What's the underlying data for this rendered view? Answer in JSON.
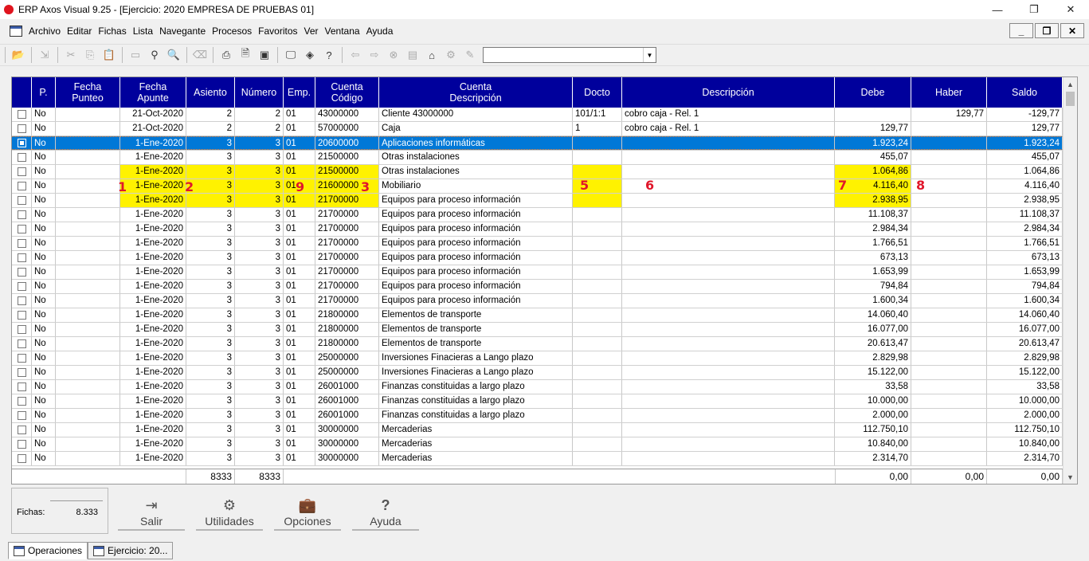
{
  "window": {
    "title": "ERP Axos Visual 9.25 - [Ejercicio: 2020  EMPRESA DE PRUEBAS 01]"
  },
  "menu": [
    "Archivo",
    "Editar",
    "Fichas",
    "Lista",
    "Navegante",
    "Procesos",
    "Favoritos",
    "Ver",
    "Ventana",
    "Ayuda"
  ],
  "headers": {
    "p": "P.",
    "fecha_punteo": "Fecha\nPunteo",
    "fecha_apunte": "Fecha\nApunte",
    "asiento": "Asiento",
    "numero": "Número",
    "emp": "Emp.",
    "cuenta_codigo": "Cuenta\nCódigo",
    "cuenta_desc": "Cuenta\nDescripción",
    "docto": "Docto",
    "descripcion": "Descripción",
    "debe": "Debe",
    "haber": "Haber",
    "saldo": "Saldo"
  },
  "rows": [
    {
      "p": "No",
      "fp": "",
      "fa": "21-Oct-2020",
      "as": "2",
      "nu": "2",
      "em": "01",
      "cc": "43000000",
      "cd": "Cliente 43000000",
      "dc": "101/1:1",
      "de": "cobro caja - Rel. 1",
      "debe": "",
      "haber": "129,77",
      "saldo": "-129,77"
    },
    {
      "p": "No",
      "fp": "",
      "fa": "21-Oct-2020",
      "as": "2",
      "nu": "2",
      "em": "01",
      "cc": "57000000",
      "cd": "Caja",
      "dc": "1",
      "de": "cobro caja - Rel. 1",
      "debe": "129,77",
      "haber": "",
      "saldo": "129,77"
    },
    {
      "p": "No",
      "fp": "",
      "fa": "1-Ene-2020",
      "as": "3",
      "nu": "3",
      "em": "01",
      "cc": "20600000",
      "cd": "Aplicaciones informáticas",
      "dc": "",
      "de": "",
      "debe": "1.923,24",
      "haber": "",
      "saldo": "1.923,24"
    },
    {
      "p": "No",
      "fp": "",
      "fa": "1-Ene-2020",
      "as": "3",
      "nu": "3",
      "em": "01",
      "cc": "21500000",
      "cd": "Otras instalaciones",
      "dc": "",
      "de": "",
      "debe": "455,07",
      "haber": "",
      "saldo": "455,07"
    },
    {
      "p": "No",
      "fp": "",
      "fa": "1-Ene-2020",
      "as": "3",
      "nu": "3",
      "em": "01",
      "cc": "21500000",
      "cd": "Otras instalaciones",
      "dc": "",
      "de": "",
      "debe": "1.064,86",
      "haber": "",
      "saldo": "1.064,86"
    },
    {
      "p": "No",
      "fp": "",
      "fa": "1-Ene-2020",
      "as": "3",
      "nu": "3",
      "em": "01",
      "cc": "21600000",
      "cd": "Mobiliario",
      "dc": "",
      "de": "",
      "debe": "4.116,40",
      "haber": "",
      "saldo": "4.116,40"
    },
    {
      "p": "No",
      "fp": "",
      "fa": "1-Ene-2020",
      "as": "3",
      "nu": "3",
      "em": "01",
      "cc": "21700000",
      "cd": "Equipos para proceso información",
      "dc": "",
      "de": "",
      "debe": "2.938,95",
      "haber": "",
      "saldo": "2.938,95"
    },
    {
      "p": "No",
      "fp": "",
      "fa": "1-Ene-2020",
      "as": "3",
      "nu": "3",
      "em": "01",
      "cc": "21700000",
      "cd": "Equipos para proceso información",
      "dc": "",
      "de": "",
      "debe": "11.108,37",
      "haber": "",
      "saldo": "11.108,37"
    },
    {
      "p": "No",
      "fp": "",
      "fa": "1-Ene-2020",
      "as": "3",
      "nu": "3",
      "em": "01",
      "cc": "21700000",
      "cd": "Equipos para proceso información",
      "dc": "",
      "de": "",
      "debe": "2.984,34",
      "haber": "",
      "saldo": "2.984,34"
    },
    {
      "p": "No",
      "fp": "",
      "fa": "1-Ene-2020",
      "as": "3",
      "nu": "3",
      "em": "01",
      "cc": "21700000",
      "cd": "Equipos para proceso información",
      "dc": "",
      "de": "",
      "debe": "1.766,51",
      "haber": "",
      "saldo": "1.766,51"
    },
    {
      "p": "No",
      "fp": "",
      "fa": "1-Ene-2020",
      "as": "3",
      "nu": "3",
      "em": "01",
      "cc": "21700000",
      "cd": "Equipos para proceso información",
      "dc": "",
      "de": "",
      "debe": "673,13",
      "haber": "",
      "saldo": "673,13"
    },
    {
      "p": "No",
      "fp": "",
      "fa": "1-Ene-2020",
      "as": "3",
      "nu": "3",
      "em": "01",
      "cc": "21700000",
      "cd": "Equipos para proceso información",
      "dc": "",
      "de": "",
      "debe": "1.653,99",
      "haber": "",
      "saldo": "1.653,99"
    },
    {
      "p": "No",
      "fp": "",
      "fa": "1-Ene-2020",
      "as": "3",
      "nu": "3",
      "em": "01",
      "cc": "21700000",
      "cd": "Equipos para proceso información",
      "dc": "",
      "de": "",
      "debe": "794,84",
      "haber": "",
      "saldo": "794,84"
    },
    {
      "p": "No",
      "fp": "",
      "fa": "1-Ene-2020",
      "as": "3",
      "nu": "3",
      "em": "01",
      "cc": "21700000",
      "cd": "Equipos para proceso información",
      "dc": "",
      "de": "",
      "debe": "1.600,34",
      "haber": "",
      "saldo": "1.600,34"
    },
    {
      "p": "No",
      "fp": "",
      "fa": "1-Ene-2020",
      "as": "3",
      "nu": "3",
      "em": "01",
      "cc": "21800000",
      "cd": "Elementos de transporte",
      "dc": "",
      "de": "",
      "debe": "14.060,40",
      "haber": "",
      "saldo": "14.060,40"
    },
    {
      "p": "No",
      "fp": "",
      "fa": "1-Ene-2020",
      "as": "3",
      "nu": "3",
      "em": "01",
      "cc": "21800000",
      "cd": "Elementos de transporte",
      "dc": "",
      "de": "",
      "debe": "16.077,00",
      "haber": "",
      "saldo": "16.077,00"
    },
    {
      "p": "No",
      "fp": "",
      "fa": "1-Ene-2020",
      "as": "3",
      "nu": "3",
      "em": "01",
      "cc": "21800000",
      "cd": "Elementos de transporte",
      "dc": "",
      "de": "",
      "debe": "20.613,47",
      "haber": "",
      "saldo": "20.613,47"
    },
    {
      "p": "No",
      "fp": "",
      "fa": "1-Ene-2020",
      "as": "3",
      "nu": "3",
      "em": "01",
      "cc": "25000000",
      "cd": "Inversiones Finacieras a Lango plazo",
      "dc": "",
      "de": "",
      "debe": "2.829,98",
      "haber": "",
      "saldo": "2.829,98"
    },
    {
      "p": "No",
      "fp": "",
      "fa": "1-Ene-2020",
      "as": "3",
      "nu": "3",
      "em": "01",
      "cc": "25000000",
      "cd": "Inversiones Finacieras a Lango plazo",
      "dc": "",
      "de": "",
      "debe": "15.122,00",
      "haber": "",
      "saldo": "15.122,00"
    },
    {
      "p": "No",
      "fp": "",
      "fa": "1-Ene-2020",
      "as": "3",
      "nu": "3",
      "em": "01",
      "cc": "26001000",
      "cd": "Finanzas constituidas a largo plazo",
      "dc": "",
      "de": "",
      "debe": "33,58",
      "haber": "",
      "saldo": "33,58"
    },
    {
      "p": "No",
      "fp": "",
      "fa": "1-Ene-2020",
      "as": "3",
      "nu": "3",
      "em": "01",
      "cc": "26001000",
      "cd": "Finanzas constituidas a largo plazo",
      "dc": "",
      "de": "",
      "debe": "10.000,00",
      "haber": "",
      "saldo": "10.000,00"
    },
    {
      "p": "No",
      "fp": "",
      "fa": "1-Ene-2020",
      "as": "3",
      "nu": "3",
      "em": "01",
      "cc": "26001000",
      "cd": "Finanzas constituidas a largo plazo",
      "dc": "",
      "de": "",
      "debe": "2.000,00",
      "haber": "",
      "saldo": "2.000,00"
    },
    {
      "p": "No",
      "fp": "",
      "fa": "1-Ene-2020",
      "as": "3",
      "nu": "3",
      "em": "01",
      "cc": "30000000",
      "cd": "Mercaderias",
      "dc": "",
      "de": "",
      "debe": "112.750,10",
      "haber": "",
      "saldo": "112.750,10"
    },
    {
      "p": "No",
      "fp": "",
      "fa": "1-Ene-2020",
      "as": "3",
      "nu": "3",
      "em": "01",
      "cc": "30000000",
      "cd": "Mercaderias",
      "dc": "",
      "de": "",
      "debe": "10.840,00",
      "haber": "",
      "saldo": "10.840,00"
    },
    {
      "p": "No",
      "fp": "",
      "fa": "1-Ene-2020",
      "as": "3",
      "nu": "3",
      "em": "01",
      "cc": "30000000",
      "cd": "Mercaderias",
      "dc": "",
      "de": "",
      "debe": "2.314,70",
      "haber": "",
      "saldo": "2.314,70"
    }
  ],
  "selected_row": 2,
  "highlight_rows": [
    4,
    5,
    6
  ],
  "highlight_color": "#fff200",
  "selection_color": "#0078d7",
  "header_color": "#00009c",
  "markers": [
    "1",
    "2",
    "9",
    "3",
    "5",
    "6",
    "7",
    "8"
  ],
  "totals": {
    "asiento": "8333",
    "numero": "8333",
    "debe": "0,00",
    "haber": "0,00",
    "saldo": "0,00"
  },
  "fichas": {
    "label": "Fichas:",
    "value": "8.333"
  },
  "buttons": [
    {
      "label": "Salir",
      "icon": "exit-icon"
    },
    {
      "label": "Utilidades",
      "icon": "gear-icon"
    },
    {
      "label": "Opciones",
      "icon": "briefcase-icon"
    },
    {
      "label": "Ayuda",
      "icon": "question-icon"
    }
  ],
  "tabs": [
    {
      "label": "Operaciones"
    },
    {
      "label": "Ejercicio: 20..."
    }
  ]
}
